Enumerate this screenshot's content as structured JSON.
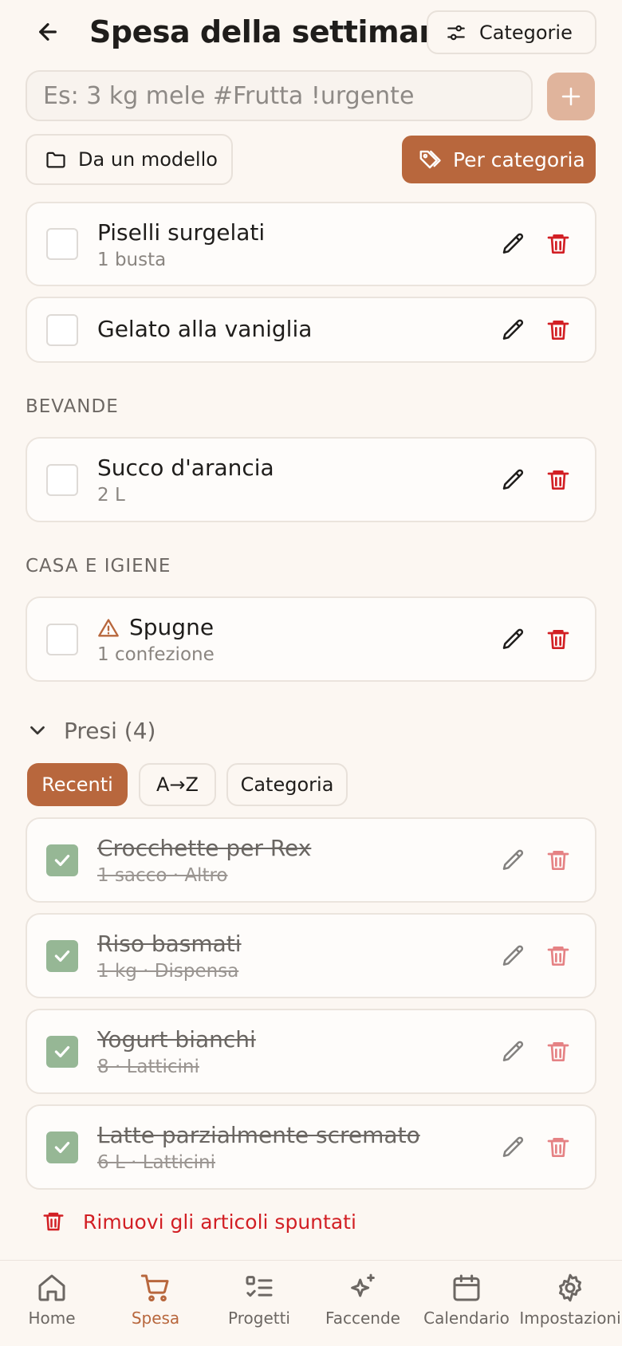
{
  "header": {
    "title": "Spesa della settimana",
    "categories_button": "Categorie"
  },
  "add_item": {
    "placeholder": "Es: 3 kg mele #Frutta !urgente"
  },
  "actions": {
    "from_template": "Da un modello",
    "by_category": "Per categoria"
  },
  "pending_items": [
    {
      "name": "Piselli surgelati",
      "detail": "1 busta"
    },
    {
      "name": "Gelato alla vaniglia",
      "detail": ""
    }
  ],
  "sections": [
    {
      "label": "BEVANDE",
      "items": [
        {
          "name": "Succo d'arancia",
          "detail": "2 L"
        }
      ]
    },
    {
      "label": "CASA E IGIENE",
      "items": [
        {
          "name": "Spugne",
          "detail": "1 confezione",
          "urgent": true
        }
      ]
    }
  ],
  "taken": {
    "label": "Presi (4)",
    "sort_chips": [
      {
        "label": "Recenti",
        "active": true
      },
      {
        "label": "A→Z",
        "active": false
      },
      {
        "label": "Categoria",
        "active": false
      }
    ],
    "items": [
      {
        "name": "Crocchette per Rex",
        "detail": "1 sacco · Altro"
      },
      {
        "name": "Riso basmati",
        "detail": "1 kg · Dispensa"
      },
      {
        "name": "Yogurt bianchi",
        "detail": "8 · Latticini"
      },
      {
        "name": "Latte parzialmente scremato",
        "detail": "6 L · Latticini"
      }
    ],
    "remove_checked": "Rimuovi gli articoli spuntati"
  },
  "bottom_nav": [
    {
      "label": "Home",
      "icon": "home-icon",
      "active": false
    },
    {
      "label": "Spesa",
      "icon": "cart-icon",
      "active": true
    },
    {
      "label": "Progetti",
      "icon": "checklist-icon",
      "active": false
    },
    {
      "label": "Faccende",
      "icon": "sparkles-icon",
      "active": false
    },
    {
      "label": "Calendario",
      "icon": "calendar-icon",
      "active": false
    },
    {
      "label": "Impostazioni",
      "icon": "gear-icon",
      "active": false
    }
  ],
  "colors": {
    "background": "#fcf7f2",
    "accent": "#b8673d",
    "accent_light": "#e0b49c",
    "checked": "#96b795",
    "danger": "#d21f24",
    "warning": "#b8673d"
  }
}
